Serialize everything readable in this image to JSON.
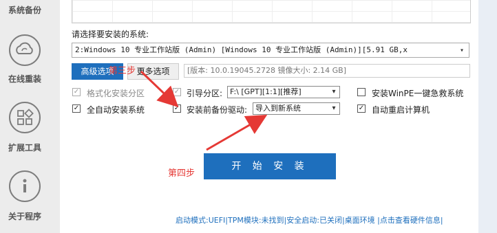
{
  "sidebar": {
    "items": [
      {
        "label": "系统备份",
        "icon": "backup-icon"
      },
      {
        "label": "在线重装",
        "icon": "cloud-reinstall-icon"
      },
      {
        "label": "扩展工具",
        "icon": "extension-tools-icon"
      },
      {
        "label": "关于程序",
        "icon": "info-icon"
      }
    ]
  },
  "main": {
    "prompt": "请选择要安装的系统:",
    "system_select": "2:Windows 10 专业工作站版 (Admin) [Windows 10 专业工作站版 (Admin)][5.91 GB,x",
    "tabs": {
      "advanced": "高级选项",
      "more": "更多选项"
    },
    "info": "[版本: 10.0.19045.2728 镜像大小: 2.14 GB]",
    "options": {
      "format": "格式化安装分区",
      "boot_partition": "引导分区:",
      "boot_partition_value": "F:\\ [GPT][1:1][推荐]",
      "install_winpe": "安装WinPE一键急救系统",
      "auto_install": "全自动安装系统",
      "backup_driver": "安装前备份驱动:",
      "backup_driver_value": "导入到新系统",
      "auto_restart": "自动重启计算机"
    },
    "start_button": "开 始 安 装",
    "annotations": {
      "step3": "第三步",
      "step4": "第四步"
    },
    "status_bar": "启动模式:UEFI|TPM模块:未找到|安全启动:已关闭|桌面环境 |点击查看硬件信息|"
  },
  "colors": {
    "accent": "#1e6fbd",
    "annotation": "#e53935",
    "sidebar_bg": "#ececec"
  }
}
